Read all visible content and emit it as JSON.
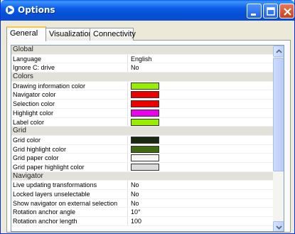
{
  "window": {
    "title": "Options",
    "icon": "app-icon",
    "buttons": [
      "minimize-icon",
      "maximize-icon",
      "close-icon"
    ]
  },
  "tabs": [
    {
      "label": "General",
      "active": true
    },
    {
      "label": "Visualization",
      "active": false
    },
    {
      "label": "Connectivity",
      "active": false
    }
  ],
  "properties": {
    "global": {
      "title": "Global",
      "language": {
        "name": "Language",
        "value": "English"
      },
      "ignore_c": {
        "name": "Ignore C: drive",
        "value": "No"
      }
    },
    "colors": {
      "title": "Colors",
      "drawing_info": {
        "name": "Drawing information color",
        "color": "#99ee00"
      },
      "navigator": {
        "name": "Navigator color",
        "color": "#ee0000"
      },
      "selection": {
        "name": "Selection color",
        "color": "#ee0000"
      },
      "highlight": {
        "name": "Highlight color",
        "color": "#ee00ee"
      },
      "label": {
        "name": "Label color",
        "color": "#99ee00"
      }
    },
    "grid": {
      "title": "Grid",
      "grid_color": {
        "name": "Grid color",
        "color": "#1a2a12"
      },
      "grid_highlight": {
        "name": "Grid highlight color",
        "color": "#3f6a12"
      },
      "grid_paper": {
        "name": "Grid paper color",
        "color": "#f6f6f6"
      },
      "grid_paper_highlight": {
        "name": "Grid paper highlight color",
        "color": "#dadada"
      }
    },
    "navigator": {
      "title": "Navigator",
      "live_updating": {
        "name": "Live updating transformations",
        "value": "No"
      },
      "locked_layers": {
        "name": "Locked layers unselectable",
        "value": "No"
      },
      "show_navigator": {
        "name": "Show navigator on external selection",
        "value": "No"
      },
      "rotation_angle": {
        "name": "Rotation anchor angle",
        "value": "10°"
      },
      "rotation_length": {
        "name": "Rotation anchor length",
        "value": "100"
      }
    }
  }
}
